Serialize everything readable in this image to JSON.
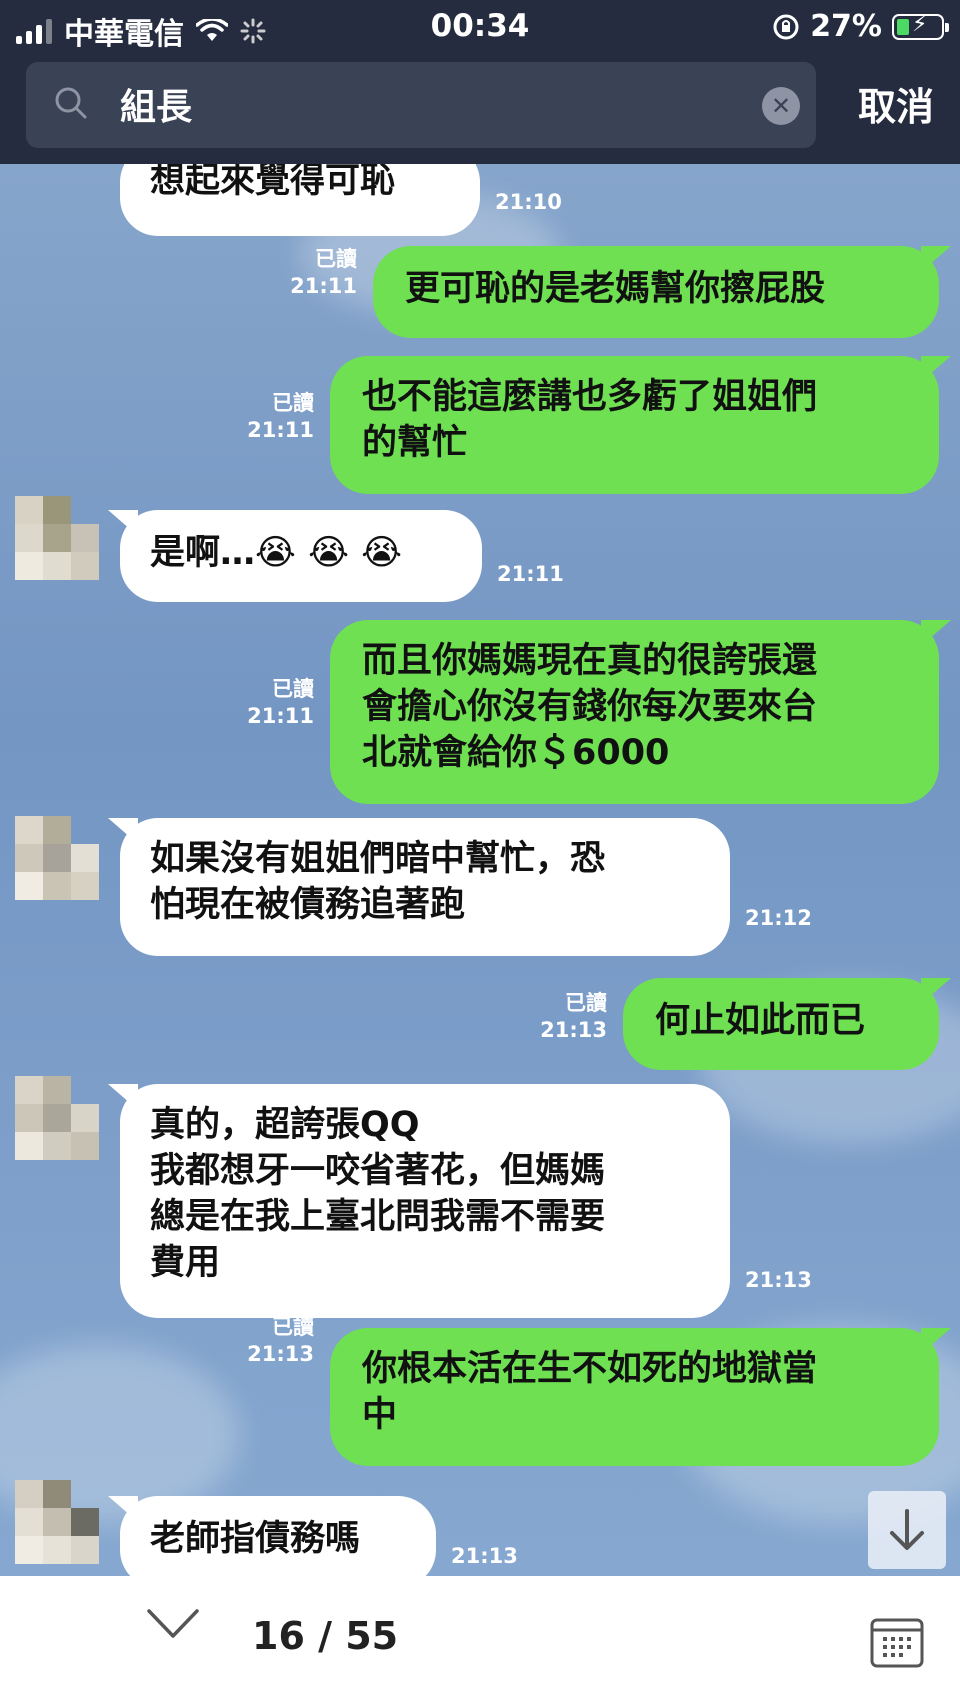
{
  "status_bar": {
    "carrier": "中華電信",
    "time": "00:34",
    "battery_percent": "27%",
    "battery_level": 0.27,
    "battery_color": "#4cd964"
  },
  "search": {
    "query": "組長",
    "cancel_label": "取消",
    "search_icon": "search-icon",
    "clear_icon": "clear-icon"
  },
  "colors": {
    "header_bg": "#252c3f",
    "outgoing_bubble": "#6ee052",
    "incoming_bubble": "#ffffff"
  },
  "messages": [
    {
      "side": "in",
      "text": "想起來覺得可恥",
      "time": "21:10"
    },
    {
      "side": "out",
      "text": "更可恥的是老媽幫你擦屁股",
      "read": "已讀",
      "time": "21:11"
    },
    {
      "side": "out",
      "text": "也不能這麼講也多虧了姐姐們\n的幫忙",
      "read": "已讀",
      "time": "21:11"
    },
    {
      "side": "in",
      "text": "是啊…😭 😭 😭",
      "time": "21:11"
    },
    {
      "side": "out",
      "text": "而且你媽媽現在真的很誇張還\n會擔心你沒有錢你每次要來台\n北就會給你＄6000",
      "read": "已讀",
      "time": "21:11"
    },
    {
      "side": "in",
      "text": "如果沒有姐姐們暗中幫忙，恐\n怕現在被債務追著跑",
      "time": "21:12"
    },
    {
      "side": "out",
      "text": "何止如此而已",
      "read": "已讀",
      "time": "21:13"
    },
    {
      "side": "in",
      "text": "真的，超誇張QQ\n我都想牙一咬省著花，但媽媽\n總是在我上臺北問我需不需要\n費用",
      "time": "21:13"
    },
    {
      "side": "out",
      "text": "你根本活在生不如死的地獄當\n中",
      "read": "已讀",
      "time": "21:13"
    },
    {
      "side": "in",
      "text": "老師指債務嗎",
      "time": "21:13"
    }
  ],
  "bottom_bar": {
    "counter": "16 / 55",
    "down_icon": "chevron-down-icon",
    "calendar_icon": "calendar-icon",
    "scroll_icon": "arrow-down-icon"
  }
}
